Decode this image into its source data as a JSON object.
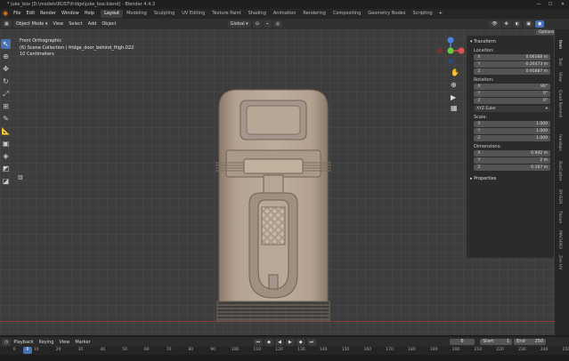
{
  "window": {
    "title": "* juke_box [D:\\models\\RUST\\fridge\\juke_box.blend] - Blender 4.4.3"
  },
  "menu": {
    "items": [
      "File",
      "Edit",
      "Render",
      "Window",
      "Help"
    ]
  },
  "workspaces": [
    {
      "label": "Layout",
      "active": true
    },
    {
      "label": "Modeling"
    },
    {
      "label": "Sculpting"
    },
    {
      "label": "UV Editing"
    },
    {
      "label": "Texture Paint"
    },
    {
      "label": "Shading"
    },
    {
      "label": "Animation"
    },
    {
      "label": "Rendering"
    },
    {
      "label": "Compositing"
    },
    {
      "label": "Geometry Nodes"
    },
    {
      "label": "Scripting"
    }
  ],
  "header": {
    "mode": "Object Mode",
    "view": "View",
    "select": "Select",
    "add": "Add",
    "object": "Object",
    "orientation": "Global",
    "options": "Options"
  },
  "overlay": {
    "line1": "Front Orthographic",
    "line2": "(6) Scene Collection | fridge_door_behind_High.022",
    "line3": "10 Centimeters"
  },
  "transform": {
    "title": "Transform",
    "location_label": "Location:",
    "location": [
      {
        "axis": "X",
        "value": "0.06168 m"
      },
      {
        "axis": "Y",
        "value": "-0.26473 m"
      },
      {
        "axis": "Z",
        "value": "0.95887 m"
      }
    ],
    "rotation_label": "Rotation:",
    "rotation": [
      {
        "axis": "X",
        "value": "90°"
      },
      {
        "axis": "Y",
        "value": "0°"
      },
      {
        "axis": "Z",
        "value": "0°"
      }
    ],
    "rotation_mode": "XYZ Euler",
    "scale_label": "Scale:",
    "scale": [
      {
        "axis": "X",
        "value": "1.000"
      },
      {
        "axis": "Y",
        "value": "1.000"
      },
      {
        "axis": "Z",
        "value": "1.000"
      }
    ],
    "dimensions_label": "Dimensions:",
    "dimensions": [
      {
        "axis": "X",
        "value": "0.942 m"
      },
      {
        "axis": "Y",
        "value": "2 m"
      },
      {
        "axis": "Z",
        "value": "0.167 m"
      }
    ],
    "properties": "Properties"
  },
  "sidetabs": [
    "Item",
    "Tool",
    "View",
    "Quad Remesh",
    "Hardops",
    "BoxCutter",
    "BY-GEN",
    "Tissue",
    "MACHIN3",
    "Zen UV"
  ],
  "timeline": {
    "playback": "Playback",
    "keying": "Keying",
    "view": "View",
    "marker": "Marker",
    "current_frame": "6",
    "start_label": "Start",
    "start": "1",
    "end_label": "End",
    "end": "250",
    "ticks": [
      "0",
      "10",
      "20",
      "30",
      "40",
      "50",
      "60",
      "70",
      "80",
      "90",
      "100",
      "110",
      "120",
      "130",
      "140",
      "150",
      "160",
      "170",
      "180",
      "190",
      "200",
      "210",
      "220",
      "230",
      "240",
      "250"
    ]
  }
}
